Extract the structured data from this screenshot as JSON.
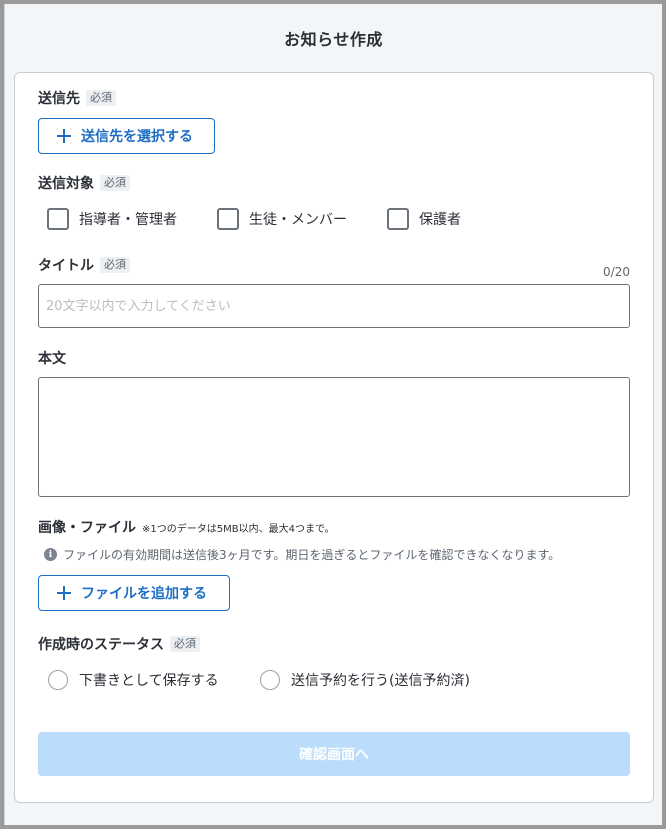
{
  "header": {
    "title": "お知らせ作成"
  },
  "required_badge": "必須",
  "recipients": {
    "label": "送信先",
    "add_button": "送信先を選択する"
  },
  "target": {
    "label": "送信対象",
    "options": [
      {
        "label": "指導者・管理者",
        "checked": false
      },
      {
        "label": "生徒・メンバー",
        "checked": false
      },
      {
        "label": "保護者",
        "checked": false
      }
    ]
  },
  "title_field": {
    "label": "タイトル",
    "counter": "0/20",
    "value": "",
    "placeholder": "20文字以内で入力してください"
  },
  "body_field": {
    "label": "本文",
    "value": ""
  },
  "attachments": {
    "label": "画像・ファイル",
    "note": "※1つのデータは5MB以内、最大4つまで。",
    "info": "ファイルの有効期間は送信後3ヶ月です。期日を過ぎるとファイルを確認できなくなります。",
    "info_icon": "info-icon",
    "add_button": "ファイルを追加する"
  },
  "status": {
    "label": "作成時のステータス",
    "options": [
      {
        "label": "下書きとして保存する",
        "selected": false
      },
      {
        "label": "送信予約を行う(送信予約済)",
        "selected": false
      }
    ]
  },
  "submit": {
    "label": "確認画面へ",
    "disabled": true
  },
  "colors": {
    "accent": "#1e6fc4",
    "submit_disabled": "#bcdcfb",
    "page_background": "#f3f6f9"
  }
}
